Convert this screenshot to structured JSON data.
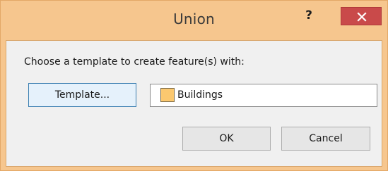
{
  "window": {
    "title": "Union",
    "help_label": "?",
    "close_icon": "close-icon",
    "frame_color": "#f6c68e",
    "close_color": "#c94a4a"
  },
  "dialog": {
    "prompt": "Choose a template to create feature(s) with:",
    "template_button_label": "Template...",
    "template_field": {
      "value": "Buildings",
      "swatch_color": "#fbc86f"
    },
    "ok_label": "OK",
    "cancel_label": "Cancel"
  }
}
